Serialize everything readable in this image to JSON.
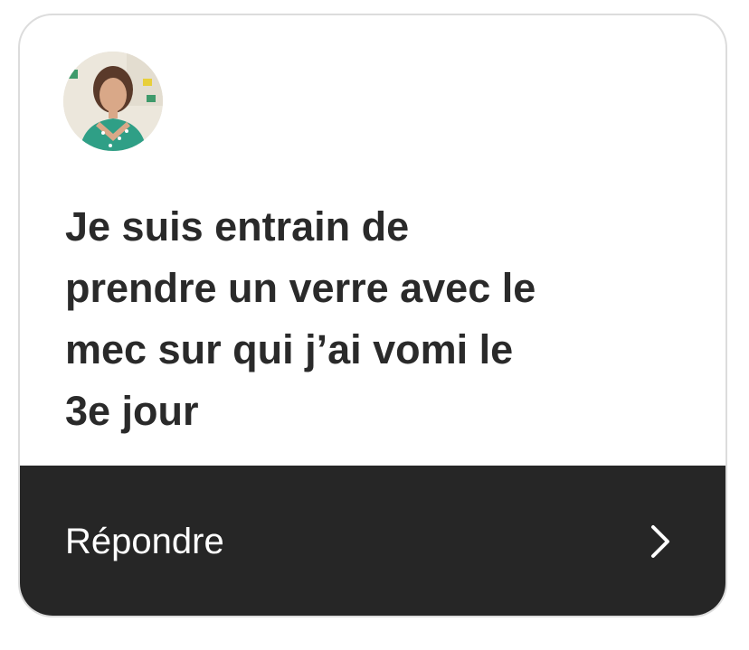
{
  "card": {
    "message": "Je suis entrain de\nprendre un verre avec le\nmec sur qui j’ai vomi le\n3e jour",
    "reply_label": "Répondre",
    "reply_icon": "chevron-right-icon",
    "avatar_icon": "profile-photo"
  },
  "colors": {
    "card_background": "#ffffff",
    "card_border": "#dcdcdc",
    "text": "#2a2a2a",
    "reply_bar": "#262626",
    "reply_text": "#ffffff"
  }
}
